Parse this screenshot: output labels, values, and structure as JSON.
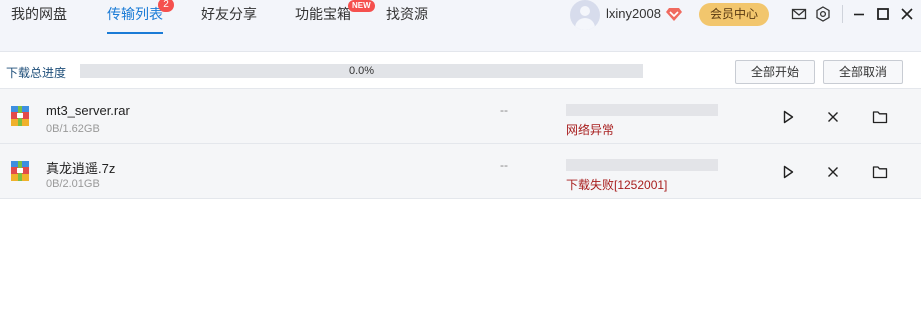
{
  "nav": {
    "tabs": [
      {
        "label": "我的网盘"
      },
      {
        "label": "传输列表",
        "badge": "2"
      },
      {
        "label": "好友分享"
      },
      {
        "label": "功能宝箱",
        "badge": "NEW"
      },
      {
        "label": "找资源"
      }
    ],
    "active_tab": "传输列表",
    "username": "lxiny2008",
    "vip_button": "会员中心"
  },
  "progress": {
    "label": "下载总进度",
    "percent_text": "0.0%",
    "percent": 0.0,
    "start_all": "全部开始",
    "cancel_all": "全部取消"
  },
  "downloads": [
    {
      "name": "mt3_server.rar",
      "size": "0B/1.62GB",
      "speed": "--",
      "status": "网络异常",
      "progress": 0
    },
    {
      "name": "真龙逍遥.7z",
      "size": "0B/2.01GB",
      "speed": "--",
      "status": "下载失败[1252001]",
      "progress": 0
    }
  ],
  "colors": {
    "accent": "#1a7bd6",
    "badge": "#f5504e",
    "vip": "#f2c66d",
    "error": "#a81e1e"
  },
  "icons": [
    "user-avatar-icon",
    "vip-gem-icon",
    "mail-icon",
    "settings-icon",
    "minimize-icon",
    "maximize-icon",
    "close-icon",
    "archive-file-icon",
    "play-icon",
    "cancel-icon",
    "folder-icon"
  ]
}
